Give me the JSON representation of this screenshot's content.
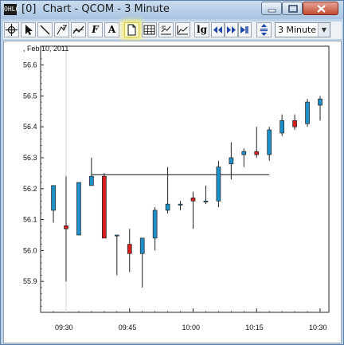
{
  "window": {
    "app_icon": "OHLC",
    "title": "[0]  Chart - QCOM - 3 Minute",
    "controls": [
      "minimize-icon",
      "maximize-icon",
      "close-icon"
    ]
  },
  "toolbar": {
    "buttons": [
      "crosshair-icon",
      "pointer-icon",
      "line-icon",
      "fibonacci-icon",
      "trend-icon",
      "font-icon",
      "text-icon",
      "page-icon",
      "table-icon",
      "chart-style-icon",
      "indicator-icon",
      "log-scale-icon",
      "scroll-left-icon",
      "scroll-right-icon",
      "zoom-icon"
    ],
    "font_label": "F",
    "text_label": "A",
    "log_label": "lg",
    "interval": "3 Minute"
  },
  "chart_data": {
    "type": "candlestick",
    "date_label": ", Feb 10, 2011",
    "ylim": [
      55.8,
      56.64
    ],
    "y_ticks": [
      "56.6",
      "56.5",
      "56.4",
      "56.3",
      "56.2",
      "56.1",
      "56.0",
      "55.9"
    ],
    "x_ticks": [
      "09:30",
      "09:45",
      "10:00",
      "10:15",
      "10:30"
    ],
    "up_color": "#1f8fc8",
    "down_color": "#d71f1f",
    "horizontal_line": {
      "value": 56.245,
      "from": "09:36",
      "to": "10:18"
    },
    "candles": [
      {
        "t": "09:27",
        "o": 56.13,
        "h": 56.21,
        "l": 56.09,
        "c": 56.21
      },
      {
        "t": "09:30",
        "o": 56.08,
        "h": 56.24,
        "l": 55.9,
        "c": 56.07
      },
      {
        "t": "09:33",
        "o": 56.05,
        "h": 56.22,
        "l": 56.05,
        "c": 56.22
      },
      {
        "t": "09:36",
        "o": 56.21,
        "h": 56.3,
        "l": 56.21,
        "c": 56.24
      },
      {
        "t": "09:39",
        "o": 56.24,
        "h": 56.25,
        "l": 56.04,
        "c": 56.04
      },
      {
        "t": "09:42",
        "o": 56.05,
        "h": 56.05,
        "l": 55.92,
        "c": 56.05
      },
      {
        "t": "09:45",
        "o": 56.02,
        "h": 56.07,
        "l": 55.93,
        "c": 55.99
      },
      {
        "t": "09:48",
        "o": 55.99,
        "h": 56.04,
        "l": 55.88,
        "c": 56.04
      },
      {
        "t": "09:51",
        "o": 56.04,
        "h": 56.14,
        "l": 56.0,
        "c": 56.13
      },
      {
        "t": "09:54",
        "o": 56.13,
        "h": 56.27,
        "l": 56.12,
        "c": 56.15
      },
      {
        "t": "09:57",
        "o": 56.15,
        "h": 56.16,
        "l": 56.13,
        "c": 56.15
      },
      {
        "t": "10:00",
        "o": 56.17,
        "h": 56.19,
        "l": 56.07,
        "c": 56.16
      },
      {
        "t": "10:03",
        "o": 56.16,
        "h": 56.21,
        "l": 56.15,
        "c": 56.16
      },
      {
        "t": "10:06",
        "o": 56.16,
        "h": 56.29,
        "l": 56.14,
        "c": 56.27
      },
      {
        "t": "10:09",
        "o": 56.28,
        "h": 56.35,
        "l": 56.23,
        "c": 56.3
      },
      {
        "t": "10:12",
        "o": 56.31,
        "h": 56.33,
        "l": 56.27,
        "c": 56.32
      },
      {
        "t": "10:15",
        "o": 56.32,
        "h": 56.4,
        "l": 56.3,
        "c": 56.31
      },
      {
        "t": "10:18",
        "o": 56.31,
        "h": 56.4,
        "l": 56.29,
        "c": 56.39
      },
      {
        "t": "10:21",
        "o": 56.38,
        "h": 56.44,
        "l": 56.37,
        "c": 56.42
      },
      {
        "t": "10:24",
        "o": 56.42,
        "h": 56.44,
        "l": 56.39,
        "c": 56.4
      },
      {
        "t": "10:27",
        "o": 56.41,
        "h": 56.49,
        "l": 56.4,
        "c": 56.48
      },
      {
        "t": "10:30",
        "o": 56.47,
        "h": 56.5,
        "l": 56.42,
        "c": 56.49
      }
    ]
  }
}
